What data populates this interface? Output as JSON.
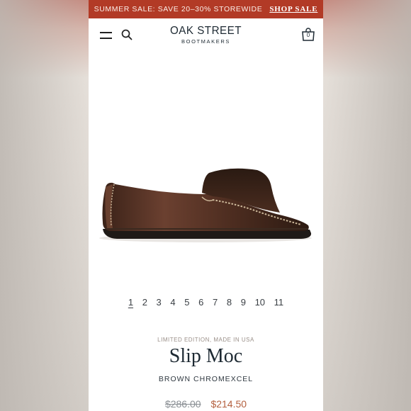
{
  "promo": {
    "text": "SUMMER SALE: SAVE 20–30% STOREWIDE",
    "link_label": "SHOP SALE"
  },
  "header": {
    "logo_main": "OAK STREET",
    "logo_sub": "BOOTMAKERS",
    "cart_count": "0",
    "icons": [
      "menu-icon",
      "search-icon",
      "shopping-bag-icon"
    ]
  },
  "pager": {
    "pages": [
      "1",
      "2",
      "3",
      "4",
      "5",
      "6",
      "7",
      "8",
      "9",
      "10",
      "11"
    ],
    "active": "1"
  },
  "product": {
    "edition": "LIMITED EDITION, MADE IN USA",
    "title": "Slip Moc",
    "variant": "BROWN CHROMEXCEL",
    "original_price": "$286.00",
    "sale_price": "$214.50"
  },
  "colors": {
    "promo_bar": "#b23a26",
    "text_dark": "#1e2a33",
    "sale_price": "#b4603f"
  }
}
